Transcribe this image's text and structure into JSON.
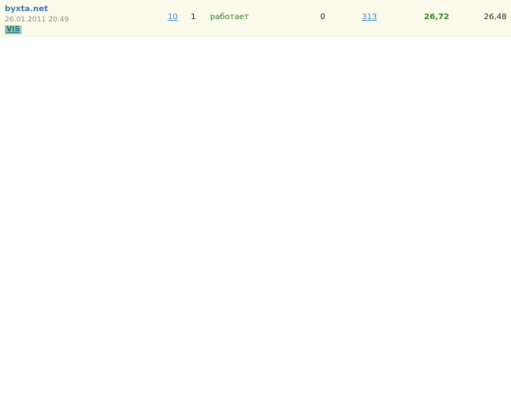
{
  "row": {
    "site_name": "byxta.net",
    "date": "26.01.2011 20:49",
    "badge": "VIS",
    "links_count": "10",
    "level": "1",
    "status": "работает",
    "zero_value": "0",
    "pages": "313",
    "price": "26,72",
    "price_alt": "26,48"
  },
  "colors": {
    "row_background": "#fcfbeb",
    "site_link": "#3a78b4",
    "link": "#3a8ad0",
    "status": "#2e7a2e",
    "price_highlight": "#2c8a1e",
    "badge_background": "#8fc9a8"
  }
}
